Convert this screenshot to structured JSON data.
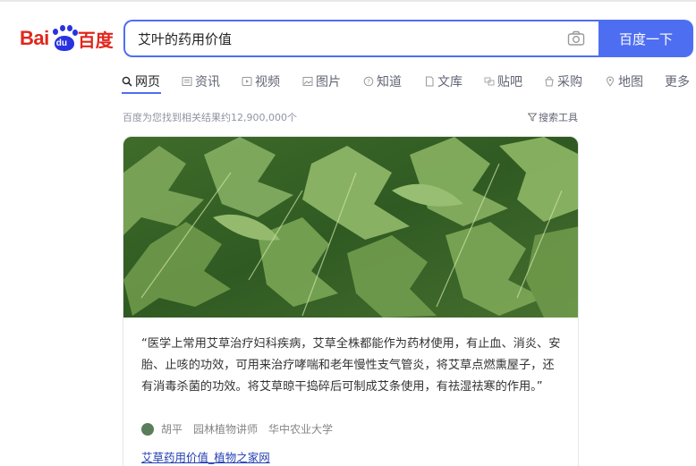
{
  "logo": {
    "bai": "Bai",
    "du": "du",
    "cn": "百度"
  },
  "search": {
    "query": "艾叶的药用价值",
    "button": "百度一下"
  },
  "tabs": [
    {
      "label": "网页",
      "icon": "search-icon"
    },
    {
      "label": "资讯",
      "icon": "news-icon"
    },
    {
      "label": "视频",
      "icon": "video-icon"
    },
    {
      "label": "图片",
      "icon": "image-icon"
    },
    {
      "label": "知道",
      "icon": "question-icon"
    },
    {
      "label": "文库",
      "icon": "doc-icon"
    },
    {
      "label": "贴吧",
      "icon": "forum-icon"
    },
    {
      "label": "采购",
      "icon": "shop-icon"
    },
    {
      "label": "地图",
      "icon": "map-icon"
    },
    {
      "label": "更多",
      "icon": ""
    }
  ],
  "result_count": "百度为您找到相关结果约12,900,000个",
  "tools_label": "搜索工具",
  "card": {
    "quote": "“医学上常用艾草治疗妇科疾病，艾草全株都能作为药材使用，有止血、消炎、安胎、止咳的功效，可用来治疗哮喘和老年慢性支气管炎，将艾草点燃熏屋子，还有消毒杀菌的功效。将艾草晾干捣碎后可制成艾条使用，有祛湿祛寒的作用。”",
    "author_name": "胡平",
    "author_title": "园林植物讲师",
    "author_org": "华中农业大学",
    "source_link": "艾草药用价值_植物之家网"
  },
  "colors": {
    "brand_blue": "#4e6ef2",
    "brand_red": "#e1261c",
    "link": "#2440b3"
  }
}
